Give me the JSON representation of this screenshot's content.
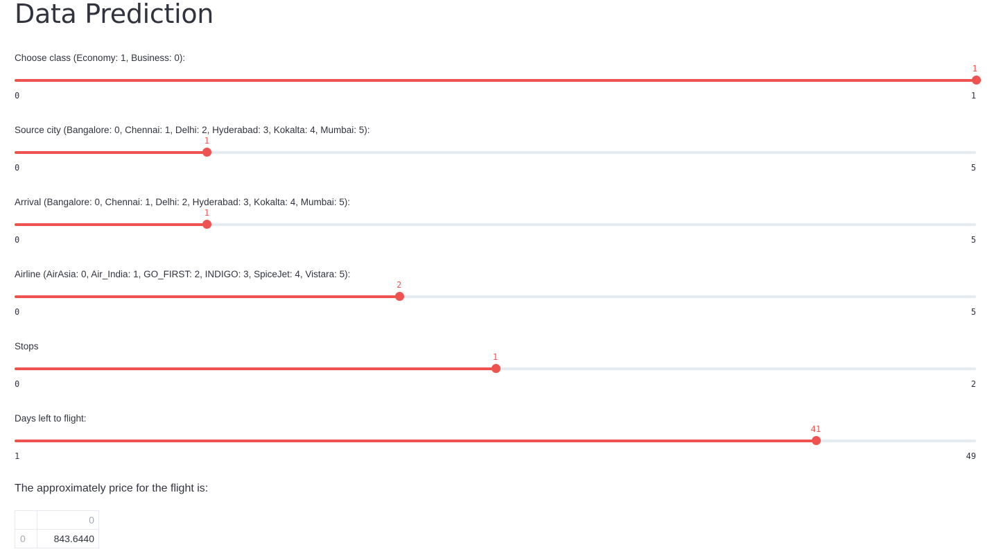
{
  "page": {
    "title": "Data Prediction"
  },
  "sliders": [
    {
      "id": "class",
      "label": "Choose class (Economy: 1, Business: 0):",
      "min": 0,
      "max": 1,
      "value": 1,
      "min_label": "0",
      "max_label": "1",
      "value_label": "1"
    },
    {
      "id": "source-city",
      "label": "Source city (Bangalore: 0, Chennai: 1, Delhi: 2, Hyderabad: 3, Kokalta: 4, Mumbai: 5):",
      "min": 0,
      "max": 5,
      "value": 1,
      "min_label": "0",
      "max_label": "5",
      "value_label": "1"
    },
    {
      "id": "arrival",
      "label": "Arrival (Bangalore: 0, Chennai: 1, Delhi: 2, Hyderabad: 3, Kokalta: 4, Mumbai: 5):",
      "min": 0,
      "max": 5,
      "value": 1,
      "min_label": "0",
      "max_label": "5",
      "value_label": "1"
    },
    {
      "id": "airline",
      "label": "Airline (AirAsia: 0, Air_India: 1, GO_FIRST: 2, INDIGO: 3, SpiceJet: 4, Vistara: 5):",
      "min": 0,
      "max": 5,
      "value": 2,
      "min_label": "0",
      "max_label": "5",
      "value_label": "2"
    },
    {
      "id": "stops",
      "label": "Stops",
      "min": 0,
      "max": 2,
      "value": 1,
      "min_label": "0",
      "max_label": "2",
      "value_label": "1"
    },
    {
      "id": "days-left",
      "label": "Days left to flight:",
      "min": 1,
      "max": 49,
      "value": 41,
      "min_label": "1",
      "max_label": "49",
      "value_label": "41"
    }
  ],
  "result": {
    "text": "The approximately price for the flight is:",
    "table": {
      "column_header": "0",
      "row_index": "0",
      "value": "843.6440"
    }
  },
  "colors": {
    "accent": "#ef5350",
    "track": "#e6eaf1",
    "text": "#31333f",
    "muted": "#a3a8b4"
  }
}
